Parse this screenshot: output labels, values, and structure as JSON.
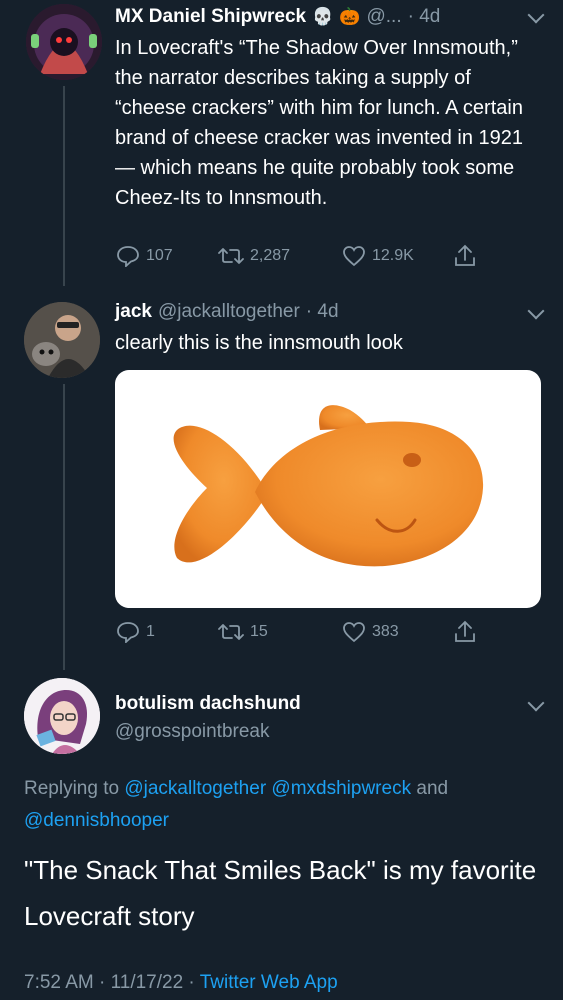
{
  "tweet1": {
    "name": "MX Daniel Shipwreck",
    "handle": "@...",
    "time": "· 4d",
    "text": "In Lovecraft's “The Shadow Over Innsmouth,” the narrator describes taking a supply of “cheese crackers” with him for lunch. A certain brand of cheese cracker was invented in 1921 — which means he quite probably took some Cheez-Its to Innsmouth.",
    "replies": "107",
    "retweets": "2,287",
    "likes": "12.9K",
    "badge_icons": [
      "skull-icon",
      "pumpkin-icon"
    ]
  },
  "tweet2": {
    "name": "jack",
    "handle": "@jackalltogether",
    "time": "· 4d",
    "text": "clearly this is the innsmouth look",
    "replies": "1",
    "retweets": "15",
    "likes": "383"
  },
  "tweet3": {
    "name": "botulism dachshund",
    "handle": "@grosspointbreak",
    "replying_prefix": "Replying to",
    "replying_handles_line1": "@jackalltogether @mxdshipwreck",
    "replying_and": "and",
    "replying_handles_line2": "@dennisbhooper",
    "text": "\"The Snack That Smiles Back\" is my favorite Lovecraft story",
    "timestamp": "7:52 AM · 11/17/22 ·",
    "client": "Twitter Web App"
  },
  "colors": {
    "background": "#15202b",
    "muted": "#8899a6",
    "link": "#1da1f2",
    "cracker": "#f08a2c"
  }
}
